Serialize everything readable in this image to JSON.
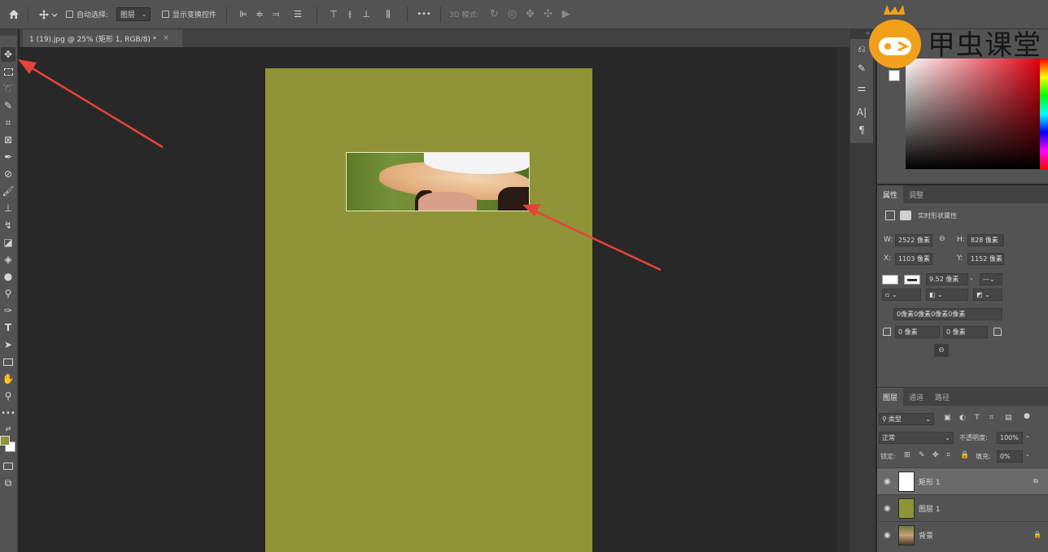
{
  "options_bar": {
    "auto_select_label": "自动选择:",
    "auto_select_value": "图层",
    "show_transform_label": "显示变换控件",
    "more_label": "•••",
    "mode_3d_label": "3D 模式:"
  },
  "document": {
    "tab_title": "1 (19).jpg @ 25% (矩形 1, RGB/8) *",
    "close_glyph": "×",
    "canvas_color": "#8f9437"
  },
  "colors": {
    "foreground": "#8f9437",
    "background": "#ffffff",
    "accent_arrow": "#e8423a"
  },
  "properties": {
    "tabs": [
      "属性",
      "调整"
    ],
    "title": "实时形状属性",
    "w_label": "W:",
    "w_value": "2522 像素",
    "h_label": "H:",
    "h_value": "828 像素",
    "x_label": "X:",
    "x_value": "1103 像素",
    "y_label": "Y:",
    "y_value": "1152 像素",
    "stroke_width": "9.52 像素",
    "radius_all": "0像素0像素0像素0像素",
    "radius_tl": "0 像素",
    "radius_tr": "0 像素"
  },
  "layers_panel": {
    "tabs": [
      "图层",
      "通道",
      "路径"
    ],
    "filter_label": "类型",
    "blend_mode": "正常",
    "opacity_label": "不透明度:",
    "opacity_value": "100%",
    "lock_label": "锁定:",
    "fill_label": "填充:",
    "fill_value": "0%",
    "layers": [
      {
        "name": "矩形 1",
        "selected": true
      },
      {
        "name": "图层 1",
        "selected": false
      },
      {
        "name": "背景",
        "selected": false
      }
    ]
  },
  "logo": {
    "text": "甲虫课堂"
  }
}
